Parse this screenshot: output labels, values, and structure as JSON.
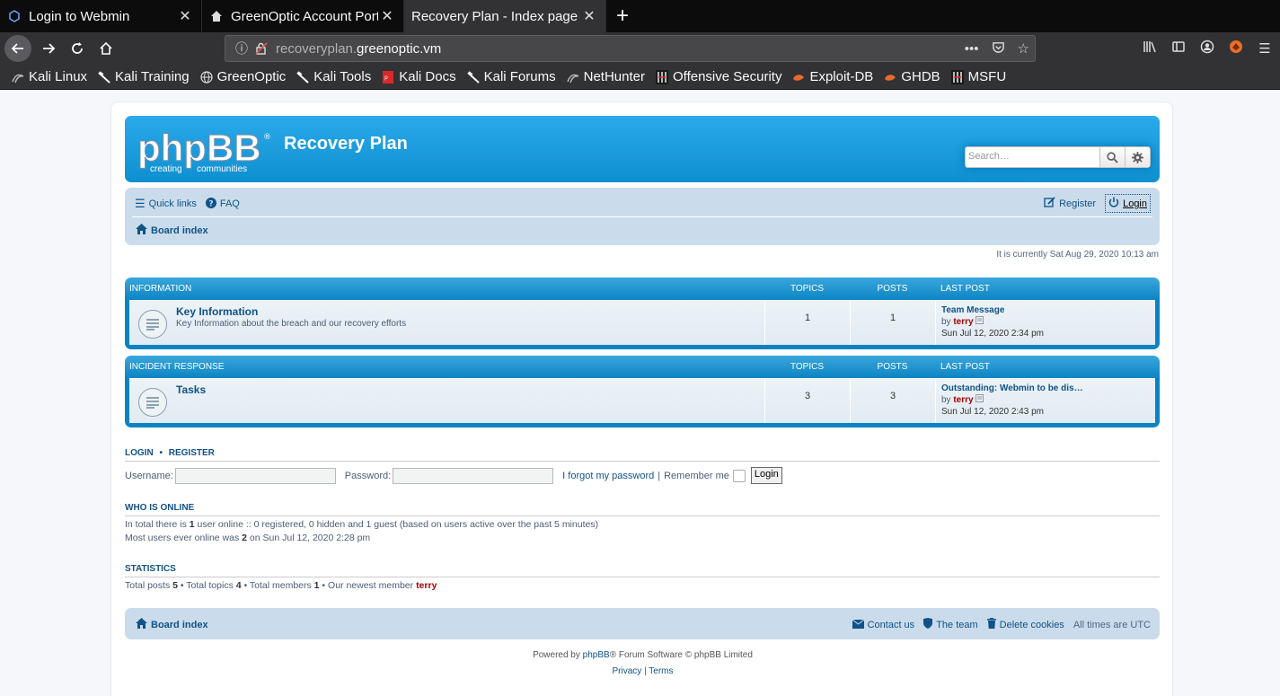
{
  "browser": {
    "tabs": [
      {
        "title": "Login to Webmin",
        "icon": "webmin-icon",
        "active": false
      },
      {
        "title": "GreenOptic Account Port",
        "icon": "house-icon",
        "active": false
      },
      {
        "title": "Recovery Plan - Index page",
        "icon": "",
        "active": true
      }
    ],
    "url_prefix": "recoveryplan.",
    "url_domain": "greenoptic.vm",
    "bookmarks": [
      {
        "label": "Kali Linux",
        "icon": "kali-icon"
      },
      {
        "label": "Kali Training",
        "icon": "kali-icon"
      },
      {
        "label": "GreenOptic",
        "icon": "globe-icon"
      },
      {
        "label": "Kali Tools",
        "icon": "kali-icon"
      },
      {
        "label": "Kali Docs",
        "icon": "docs-icon"
      },
      {
        "label": "Kali Forums",
        "icon": "kali-icon"
      },
      {
        "label": "NetHunter",
        "icon": "nethunter-icon"
      },
      {
        "label": "Offensive Security",
        "icon": "offsec-icon"
      },
      {
        "label": "Exploit-DB",
        "icon": "exploitdb-icon"
      },
      {
        "label": "GHDB",
        "icon": "ghdb-icon"
      },
      {
        "label": "MSFU",
        "icon": "msfu-icon"
      }
    ]
  },
  "header": {
    "logo_text": "phpBB",
    "logo_sub1": "creating",
    "logo_sub2": "communities",
    "site_name": "Recovery Plan",
    "search_placeholder": "Search…"
  },
  "nav": {
    "quick_links": "Quick links",
    "faq": "FAQ",
    "register": "Register",
    "login": "Login",
    "board_index": "Board index"
  },
  "current_time": "It is currently Sat Aug 29, 2020 10:13 am",
  "columns": {
    "topics": "TOPICS",
    "posts": "POSTS",
    "last_post": "LAST POST"
  },
  "categories": [
    {
      "name": "INFORMATION",
      "forum": {
        "title": "Key Information",
        "desc": "Key Information about the breach and our recovery efforts",
        "topics": "1",
        "posts": "1",
        "last_title": "Team Message",
        "last_by": "by",
        "last_user": "terry",
        "last_date": "Sun Jul 12, 2020 2:34 pm"
      }
    },
    {
      "name": "INCIDENT RESPONSE",
      "forum": {
        "title": "Tasks",
        "desc": "",
        "topics": "3",
        "posts": "3",
        "last_title": "Outstanding: Webmin to be dis…",
        "last_by": "by",
        "last_user": "terry",
        "last_date": "Sun Jul 12, 2020 2:43 pm"
      }
    }
  ],
  "login_section": {
    "heading_login": "LOGIN",
    "heading_sep": "•",
    "heading_register": "REGISTER",
    "username_label": "Username:",
    "password_label": "Password:",
    "forgot": "I forgot my password",
    "sep": "|",
    "remember": "Remember me",
    "button": "Login"
  },
  "who_online": {
    "heading": "WHO IS ONLINE",
    "line1_a": "In total there is ",
    "line1_b": "1",
    "line1_c": " user online :: 0 registered, 0 hidden and 1 guest (based on users active over the past 5 minutes)",
    "line2_a": "Most users ever online was ",
    "line2_b": "2",
    "line2_c": " on Sun Jul 12, 2020 2:28 pm"
  },
  "statistics": {
    "heading": "STATISTICS",
    "p1": "Total posts ",
    "posts": "5",
    "p2": " • Total topics ",
    "topics": "4",
    "p3": " • Total members ",
    "members": "1",
    "p4": " • Our newest member ",
    "newest": "terry"
  },
  "footer": {
    "board_index": "Board index",
    "contact": "Contact us",
    "team": "The team",
    "delete_cookies": "Delete cookies",
    "timezone": "All times are UTC",
    "powered_a": "Powered by ",
    "powered_link": "phpBB",
    "powered_b": "® Forum Software © phpBB Limited",
    "privacy": "Privacy",
    "sep": "|",
    "terms": "Terms"
  }
}
